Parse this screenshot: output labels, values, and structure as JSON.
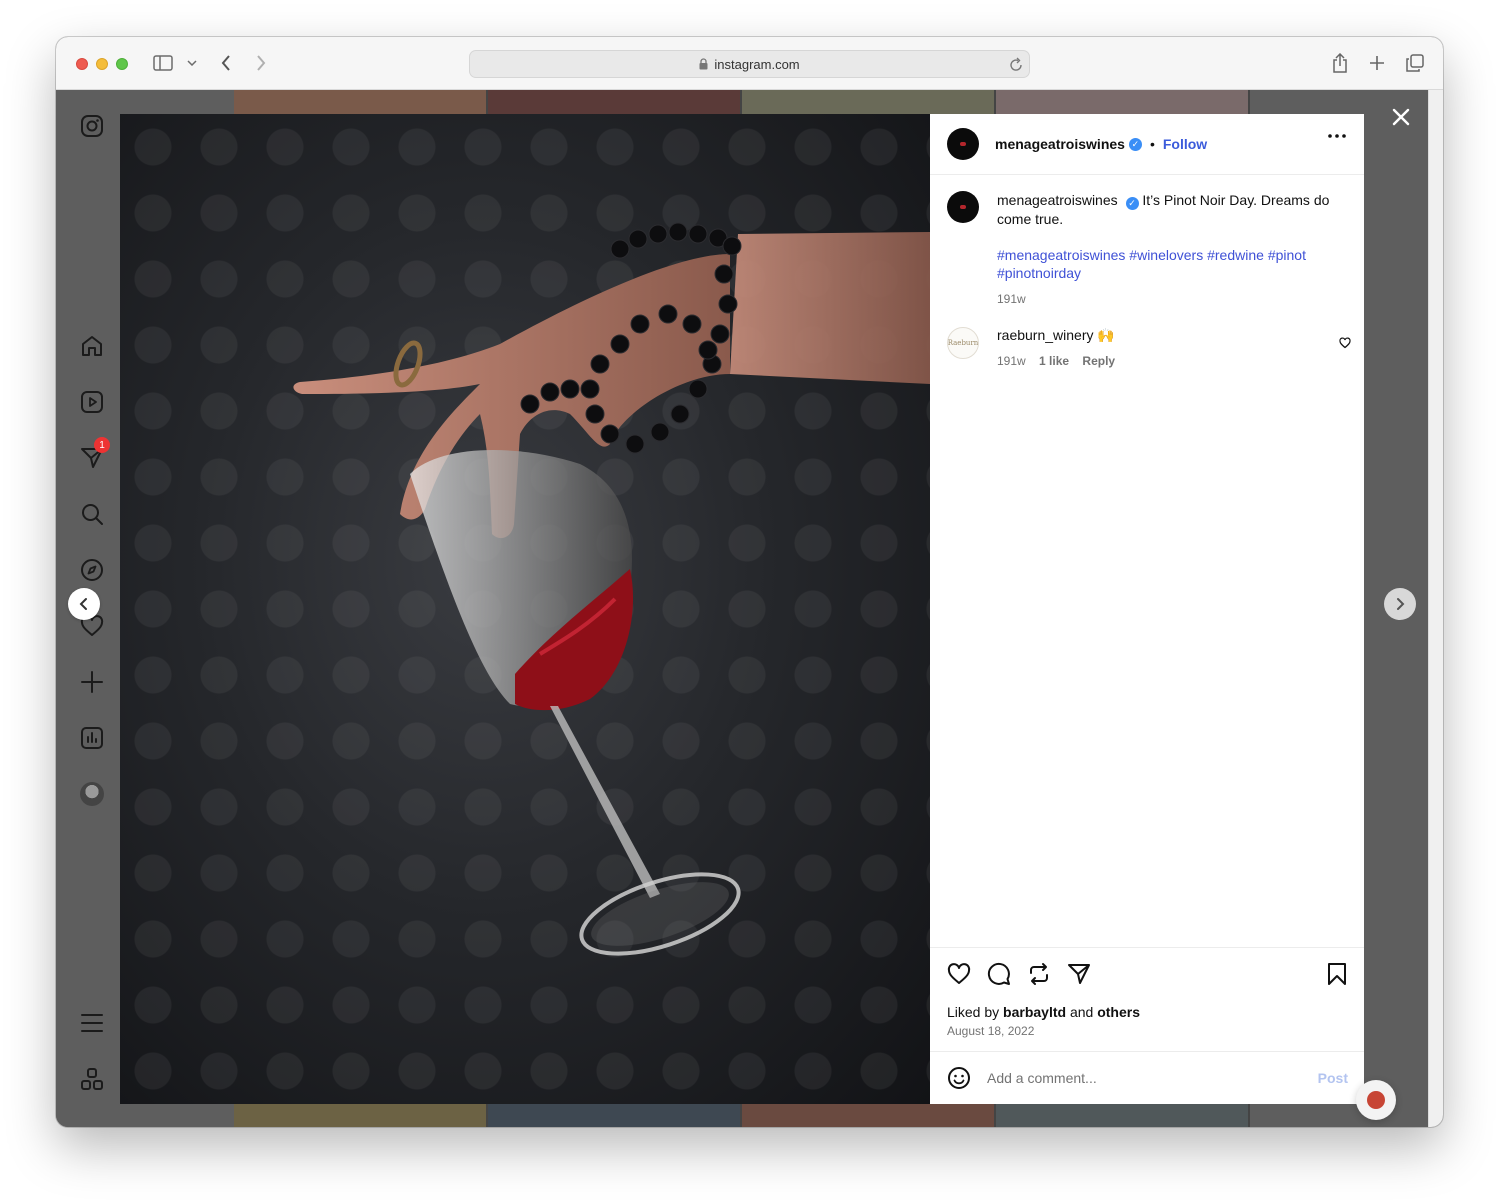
{
  "browser": {
    "url": "instagram.com"
  },
  "post": {
    "username": "menageatroiswines",
    "verified_mark": "✓",
    "dot_separator": "•",
    "follow_label": "Follow",
    "caption_username": "menageatroiswines",
    "caption_text": "It’s Pinot Noir Day. Dreams do come true.",
    "hashtags": "#menageatroiswines #winelovers #redwine #pinot #pinotnoirday",
    "caption_age": "191w",
    "comment": {
      "username": "raeburn_winery",
      "text": "🙌",
      "age": "191w",
      "likes": "1 like",
      "reply_label": "Reply"
    },
    "liked_prefix": "Liked by",
    "liked_user": "barbayltd",
    "liked_and": "and",
    "liked_others": "others",
    "date": "August 18, 2022",
    "comment_placeholder": "Add a comment...",
    "post_label": "Post"
  },
  "sidebar": {
    "notification_count": "1"
  },
  "icons": {
    "nav": [
      "instagram-logo-icon",
      "home-icon",
      "reels-icon",
      "messages-icon",
      "search-icon",
      "explore-icon",
      "heart-icon",
      "create-icon",
      "dashboard-icon",
      "profile-avatar",
      "menu-icon",
      "more-apps-icon"
    ],
    "actions": [
      "like-icon",
      "comment-icon",
      "repost-icon",
      "share-icon",
      "save-icon"
    ]
  },
  "colors": {
    "link_blue": "#3b5bdb",
    "hashtag_blue": "#3f51d6",
    "verified_blue": "#3a8ef6",
    "badge_red": "#ee3333"
  }
}
